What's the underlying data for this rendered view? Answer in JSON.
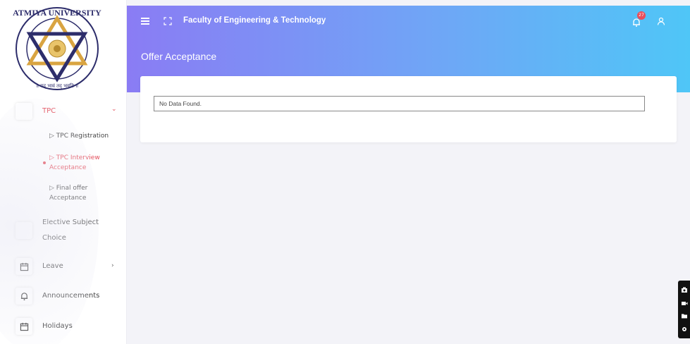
{
  "logo": {
    "university_name": "ATMIYA UNIVERSITY",
    "motto": "॥ यद् भावं तद् भवति ॥"
  },
  "header": {
    "title": "Faculty of Engineering & Technology",
    "page_title": "Offer Acceptance",
    "notification_count": "27"
  },
  "sidebar": {
    "tpc": {
      "label": "TPC"
    },
    "sub_items": [
      {
        "label": "▷ TPC Registration"
      },
      {
        "label": "▷ TPC Interview Acceptance"
      },
      {
        "label": "▷ Final offer Acceptance"
      }
    ],
    "elective": {
      "label": "Elective Subject Choice"
    },
    "leave": {
      "label": "Leave"
    },
    "announcements": {
      "label": "Announcements"
    },
    "holidays": {
      "label": "Holidays"
    }
  },
  "main": {
    "empty_message": "No Data Found."
  },
  "colors": {
    "header_gradient_start": "#8a7cf4",
    "header_gradient_end": "#4fc6f7",
    "accent": "#e4515e",
    "badge": "#e94d5a"
  },
  "icons": [
    "hamburger-icon",
    "fullscreen-icon",
    "bell-icon",
    "user-icon",
    "calendar-icon",
    "bell-outline-icon",
    "camera-icon",
    "video-icon",
    "folder-icon",
    "gear-icon"
  ]
}
